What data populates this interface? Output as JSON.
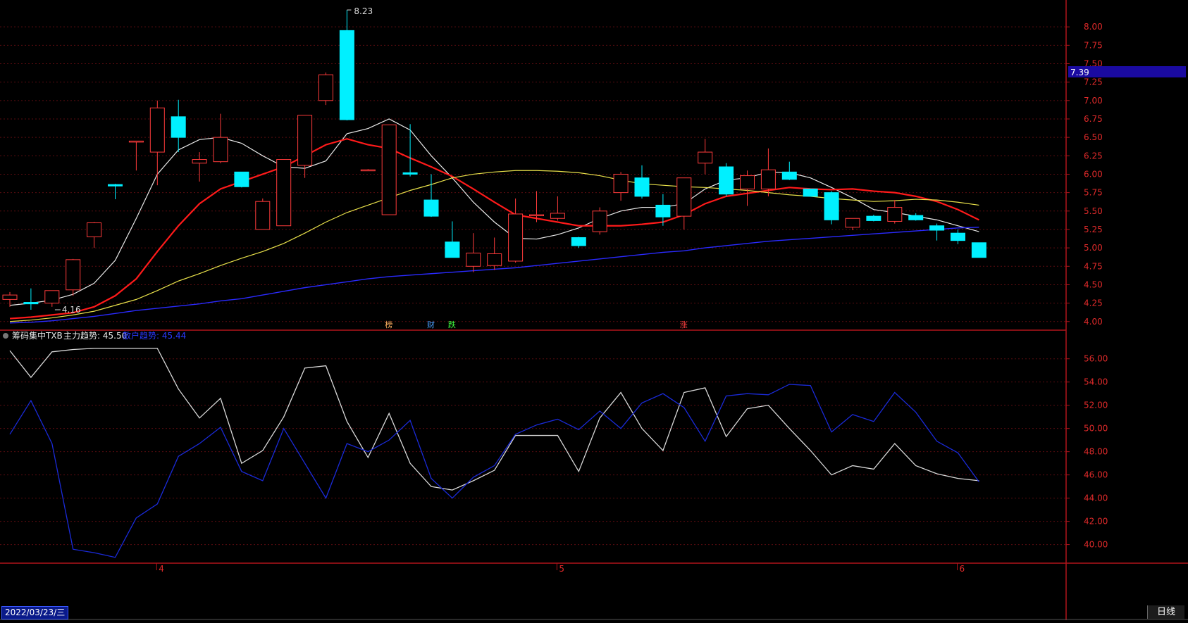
{
  "upper_panel": {
    "y_ticks": [
      "8.00",
      "7.75",
      "7.50",
      "7.25",
      "7.00",
      "6.75",
      "6.50",
      "6.25",
      "6.00",
      "5.75",
      "5.50",
      "5.25",
      "5.00",
      "4.75",
      "4.50",
      "4.25",
      "4.00"
    ],
    "current_price_tag": "7.39",
    "high_marker": "8.23",
    "low_marker": "4.16",
    "event_markers": [
      "榜",
      "财",
      "跌",
      "涨"
    ]
  },
  "indicator_header": {
    "name": "筹码集中TXB",
    "line1_label": "主力趋势: 45.50",
    "line2_label": "散户趋势: 45.44"
  },
  "lower_panel": {
    "y_ticks": [
      "56.00",
      "54.00",
      "52.00",
      "50.00",
      "48.00",
      "46.00",
      "44.00",
      "42.00",
      "40.00"
    ]
  },
  "x_axis": {
    "month_labels": [
      "4",
      "5",
      "6"
    ],
    "start_date": "2022/03/23/三"
  },
  "period_tab": "日线",
  "colors": {
    "background": "#000000",
    "axis_red": "#b0141a",
    "candle_up": "#ff3b3b",
    "candle_down": "#00f0ff",
    "ma5": "#e8e8e8",
    "ma10": "#ff1a1a",
    "ma20": "#e8e04a",
    "ma60": "#2a2aff",
    "main_trend": "#d8d8d8",
    "retail_trend": "#1a2ad8",
    "price_tag_bg": "#1a0aa0"
  },
  "chart_data": [
    {
      "type": "candlestick",
      "title": "",
      "ylim": [
        3.95,
        8.25
      ],
      "y_tick_values": [
        8.0,
        7.75,
        7.5,
        7.25,
        7.0,
        6.75,
        6.5,
        6.25,
        6.0,
        5.75,
        5.5,
        5.25,
        5.0,
        4.75,
        4.5,
        4.25,
        4.0
      ],
      "candles": [
        {
          "o": 4.3,
          "h": 4.4,
          "l": 4.2,
          "c": 4.36
        },
        {
          "o": 4.26,
          "h": 4.45,
          "l": 4.16,
          "c": 4.24
        },
        {
          "o": 4.25,
          "h": 4.42,
          "l": 4.2,
          "c": 4.42
        },
        {
          "o": 4.43,
          "h": 4.85,
          "l": 4.35,
          "c": 4.84
        },
        {
          "o": 5.15,
          "h": 5.35,
          "l": 5.0,
          "c": 5.34
        },
        {
          "o": 5.86,
          "h": 5.87,
          "l": 5.66,
          "c": 5.84
        },
        {
          "o": 6.45,
          "h": 6.45,
          "l": 6.05,
          "c": 6.45
        },
        {
          "o": 6.3,
          "h": 7.0,
          "l": 5.85,
          "c": 6.9
        },
        {
          "o": 6.78,
          "h": 7.01,
          "l": 6.3,
          "c": 6.5
        },
        {
          "o": 6.15,
          "h": 6.3,
          "l": 5.9,
          "c": 6.2
        },
        {
          "o": 6.17,
          "h": 6.82,
          "l": 6.15,
          "c": 6.5
        },
        {
          "o": 6.03,
          "h": 6.03,
          "l": 5.82,
          "c": 5.83
        },
        {
          "o": 5.25,
          "h": 5.67,
          "l": 5.25,
          "c": 5.63
        },
        {
          "o": 5.3,
          "h": 6.2,
          "l": 5.3,
          "c": 6.2
        },
        {
          "o": 6.12,
          "h": 6.8,
          "l": 5.95,
          "c": 6.8
        },
        {
          "o": 7.0,
          "h": 7.38,
          "l": 6.94,
          "c": 7.35
        },
        {
          "o": 7.95,
          "h": 8.23,
          "l": 6.73,
          "c": 6.74
        },
        {
          "o": 6.06,
          "h": 6.07,
          "l": 6.06,
          "c": 6.06
        },
        {
          "o": 5.45,
          "h": 6.67,
          "l": 5.45,
          "c": 6.67
        },
        {
          "o": 6.02,
          "h": 6.68,
          "l": 5.97,
          "c": 6.0
        },
        {
          "o": 5.65,
          "h": 6.0,
          "l": 5.42,
          "c": 5.43
        },
        {
          "o": 5.08,
          "h": 5.36,
          "l": 4.87,
          "c": 4.87
        },
        {
          "o": 4.75,
          "h": 5.2,
          "l": 4.67,
          "c": 4.93
        },
        {
          "o": 4.76,
          "h": 5.14,
          "l": 4.7,
          "c": 4.92
        },
        {
          "o": 4.82,
          "h": 5.67,
          "l": 4.8,
          "c": 5.46
        },
        {
          "o": 5.45,
          "h": 5.77,
          "l": 5.35,
          "c": 5.45
        },
        {
          "o": 5.4,
          "h": 5.7,
          "l": 5.37,
          "c": 5.47
        },
        {
          "o": 5.14,
          "h": 5.15,
          "l": 5.0,
          "c": 5.03
        },
        {
          "o": 5.22,
          "h": 5.55,
          "l": 5.18,
          "c": 5.5
        },
        {
          "o": 5.75,
          "h": 6.03,
          "l": 5.64,
          "c": 6.0
        },
        {
          "o": 5.95,
          "h": 6.12,
          "l": 5.67,
          "c": 5.7
        },
        {
          "o": 5.58,
          "h": 5.73,
          "l": 5.3,
          "c": 5.42
        },
        {
          "o": 5.43,
          "h": 5.95,
          "l": 5.25,
          "c": 5.95
        },
        {
          "o": 6.15,
          "h": 6.48,
          "l": 6.0,
          "c": 6.3
        },
        {
          "o": 6.1,
          "h": 6.15,
          "l": 5.7,
          "c": 5.73
        },
        {
          "o": 5.8,
          "h": 6.05,
          "l": 5.57,
          "c": 5.98
        },
        {
          "o": 5.8,
          "h": 6.35,
          "l": 5.7,
          "c": 6.06
        },
        {
          "o": 6.03,
          "h": 6.17,
          "l": 5.92,
          "c": 5.93
        },
        {
          "o": 5.8,
          "h": 5.8,
          "l": 5.7,
          "c": 5.7
        },
        {
          "o": 5.75,
          "h": 5.77,
          "l": 5.32,
          "c": 5.38
        },
        {
          "o": 5.28,
          "h": 5.38,
          "l": 5.24,
          "c": 5.4
        },
        {
          "o": 5.43,
          "h": 5.45,
          "l": 5.36,
          "c": 5.37
        },
        {
          "o": 5.36,
          "h": 5.65,
          "l": 5.33,
          "c": 5.55
        },
        {
          "o": 5.44,
          "h": 5.47,
          "l": 5.37,
          "c": 5.38
        },
        {
          "o": 5.3,
          "h": 5.33,
          "l": 5.1,
          "c": 5.24
        },
        {
          "o": 5.2,
          "h": 5.25,
          "l": 5.05,
          "c": 5.1
        },
        {
          "o": 5.07,
          "h": 5.07,
          "l": 4.87,
          "c": 4.87
        }
      ],
      "series": [
        {
          "values": [
            4.22,
            4.25,
            4.29,
            4.37,
            4.52,
            4.83,
            5.4,
            6.0,
            6.33,
            6.47,
            6.5,
            6.42,
            6.25,
            6.1,
            6.08,
            6.18,
            6.55,
            6.62,
            6.75,
            6.6,
            6.25,
            5.95,
            5.62,
            5.35,
            5.13,
            5.12,
            5.18,
            5.27,
            5.4,
            5.5,
            5.55,
            5.55,
            5.6,
            5.8,
            5.92,
            5.95,
            6.03,
            6.02,
            5.95,
            5.82,
            5.68,
            5.52,
            5.48,
            5.43,
            5.38,
            5.3,
            5.22
          ]
        },
        {
          "values": [
            4.04,
            4.06,
            4.09,
            4.12,
            4.2,
            4.35,
            4.58,
            4.95,
            5.3,
            5.6,
            5.8,
            5.9,
            6.0,
            6.1,
            6.25,
            6.4,
            6.48,
            6.4,
            6.35,
            6.22,
            6.1,
            5.97,
            5.8,
            5.62,
            5.45,
            5.4,
            5.35,
            5.3,
            5.3,
            5.3,
            5.32,
            5.35,
            5.45,
            5.6,
            5.7,
            5.74,
            5.78,
            5.82,
            5.8,
            5.79,
            5.8,
            5.77,
            5.75,
            5.7,
            5.63,
            5.52,
            5.38
          ]
        },
        {
          "values": [
            4.0,
            4.02,
            4.05,
            4.09,
            4.14,
            4.22,
            4.3,
            4.42,
            4.55,
            4.65,
            4.76,
            4.86,
            4.95,
            5.06,
            5.2,
            5.35,
            5.48,
            5.58,
            5.68,
            5.78,
            5.86,
            5.95,
            6.0,
            6.03,
            6.05,
            6.05,
            6.04,
            6.02,
            5.98,
            5.92,
            5.87,
            5.85,
            5.83,
            5.82,
            5.8,
            5.78,
            5.75,
            5.72,
            5.7,
            5.67,
            5.65,
            5.63,
            5.64,
            5.66,
            5.65,
            5.62,
            5.58
          ]
        },
        {
          "values": [
            3.98,
            3.99,
            4.01,
            4.04,
            4.07,
            4.11,
            4.15,
            4.18,
            4.21,
            4.24,
            4.28,
            4.31,
            4.36,
            4.41,
            4.46,
            4.5,
            4.54,
            4.58,
            4.61,
            4.63,
            4.65,
            4.67,
            4.69,
            4.71,
            4.73,
            4.76,
            4.79,
            4.82,
            4.85,
            4.88,
            4.91,
            4.94,
            4.96,
            5.0,
            5.03,
            5.06,
            5.09,
            5.11,
            5.13,
            5.15,
            5.17,
            5.19,
            5.21,
            5.23,
            5.25,
            5.27,
            5.28
          ]
        }
      ]
    },
    {
      "type": "line",
      "title": "筹码集中TXB",
      "ylim": [
        38.4,
        57.8
      ],
      "y_tick_values": [
        56,
        54,
        52,
        50,
        48,
        46,
        44,
        42,
        40
      ],
      "series": [
        {
          "name": "主力趋势",
          "values": [
            56.7,
            54.4,
            56.6,
            56.8,
            56.9,
            56.9,
            56.9,
            56.9,
            53.4,
            50.9,
            52.6,
            47.0,
            48.1,
            51.0,
            55.2,
            55.4,
            50.6,
            47.5,
            51.3,
            47.0,
            45.0,
            44.7,
            45.5,
            46.4,
            49.4,
            49.4,
            49.4,
            46.3,
            50.9,
            53.1,
            50.0,
            48.1,
            53.1,
            53.5,
            49.3,
            51.7,
            52.0,
            50.0,
            48.1,
            46.0,
            46.8,
            46.5,
            48.7,
            46.8,
            46.1,
            45.7,
            45.5
          ]
        },
        {
          "name": "散户趋势",
          "values": [
            49.5,
            52.4,
            48.7,
            39.6,
            39.3,
            38.9,
            42.3,
            43.5,
            47.6,
            48.7,
            50.1,
            46.3,
            45.5,
            50.0,
            47.0,
            44.0,
            48.7,
            48.0,
            49.0,
            50.7,
            45.7,
            44.0,
            45.8,
            46.8,
            49.5,
            50.3,
            50.8,
            49.9,
            51.5,
            50.0,
            52.2,
            53.0,
            51.8,
            48.9,
            52.8,
            53.0,
            52.9,
            53.8,
            53.7,
            49.7,
            51.2,
            50.6,
            53.1,
            51.4,
            48.9,
            47.9,
            45.4
          ]
        }
      ]
    }
  ]
}
